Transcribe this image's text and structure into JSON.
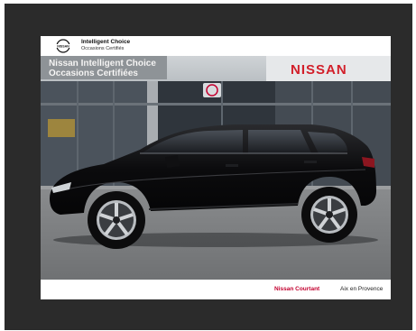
{
  "header": {
    "brand_title": "Intelligent Choice",
    "brand_subtitle": "Occasions Certifiés",
    "logo_text": "NISSAN"
  },
  "storefront": {
    "sign_line_1": "Nissan Intelligent Choice",
    "sign_line_2": "Occasions Certifiées",
    "sign_brand": "NISSAN"
  },
  "footer": {
    "dealer_name": "Nissan Courtant",
    "city": "Aix en Provence"
  },
  "colors": {
    "accent": "#c3002f",
    "frame": "#2b2b2b",
    "car": "#0d0d0f"
  }
}
